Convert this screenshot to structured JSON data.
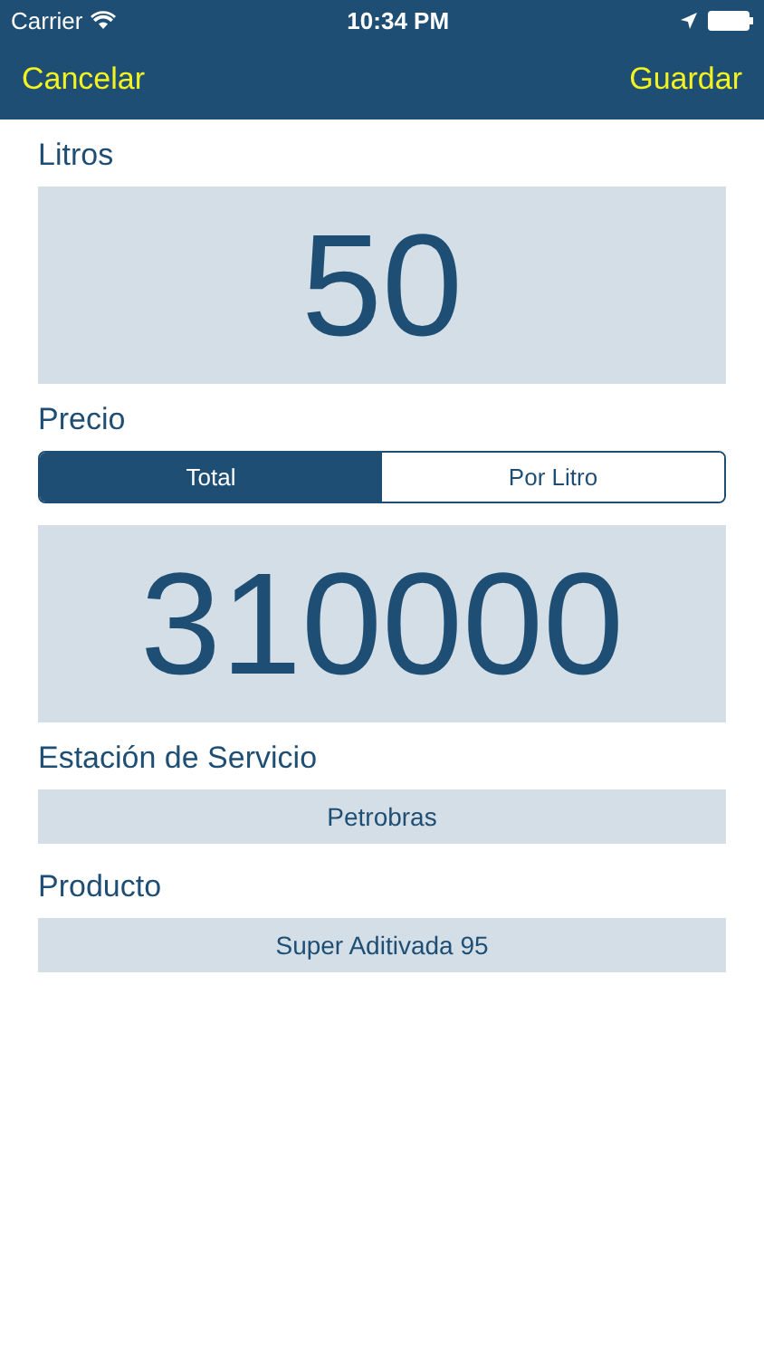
{
  "status_bar": {
    "carrier": "Carrier",
    "time": "10:34 PM"
  },
  "nav": {
    "cancel": "Cancelar",
    "save": "Guardar"
  },
  "liters": {
    "label": "Litros",
    "value": "50"
  },
  "price": {
    "label": "Precio",
    "segments": [
      {
        "label": "Total",
        "selected": true
      },
      {
        "label": "Por Litro",
        "selected": false
      }
    ],
    "value": "310000"
  },
  "station": {
    "label": "Estación de Servicio",
    "value": "Petrobras"
  },
  "product": {
    "label": "Producto",
    "value": "Super Aditivada 95"
  }
}
